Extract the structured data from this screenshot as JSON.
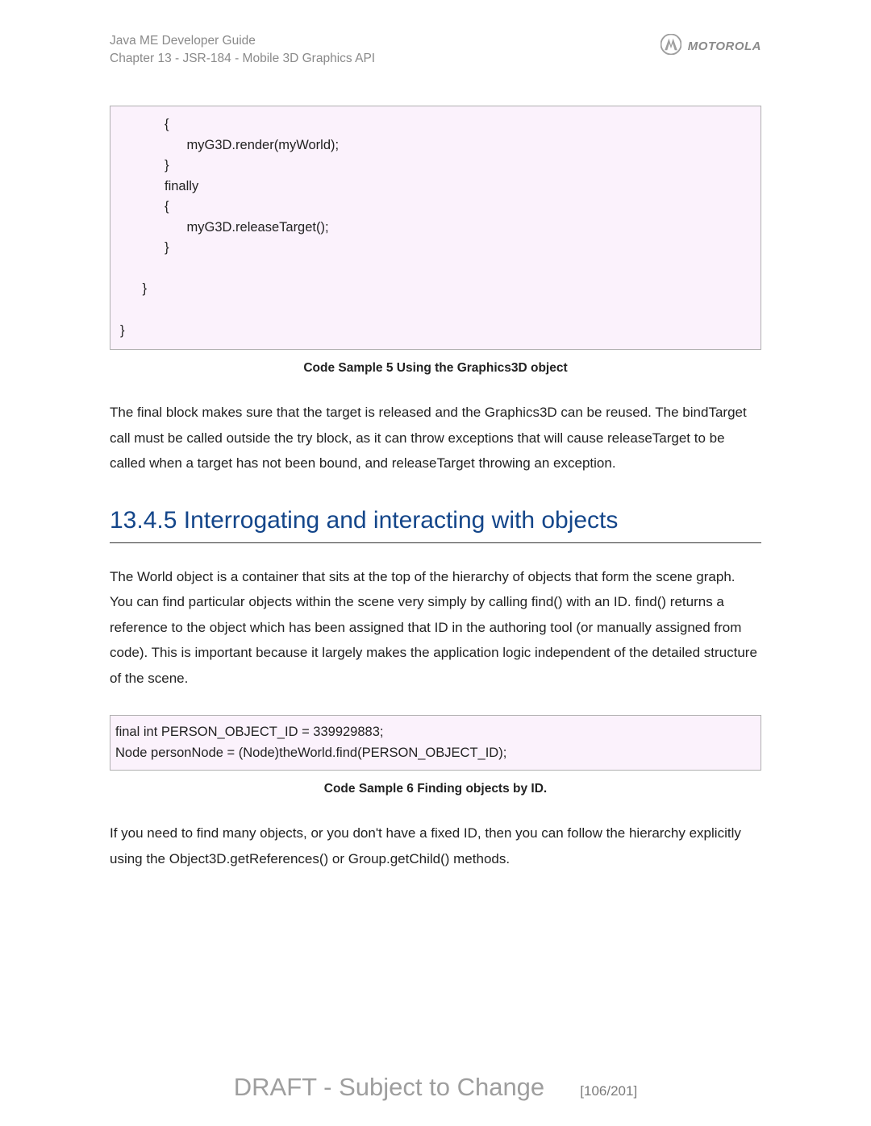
{
  "header": {
    "line1": "Java ME Developer Guide",
    "line2": "Chapter 13 - JSR-184 - Mobile 3D Graphics API",
    "brand": "MOTOROLA"
  },
  "code1": "            {\n                  myG3D.render(myWorld);\n            }\n            finally\n            {\n                  myG3D.releaseTarget();\n            }\n\n      }\n\n}",
  "caption1": "Code Sample 5 Using the Graphics3D object",
  "para1": "The final block makes sure that the target is released and the Graphics3D can be reused. The bindTarget call must be called outside the try block, as it can throw exceptions that will cause releaseTarget to be called when a target has not been bound, and releaseTarget throwing an exception.",
  "heading": "13.4.5 Interrogating and interacting with objects",
  "para2": "The World object is a container that sits at the top of the hierarchy of objects that form the scene graph. You can find particular objects within the scene very simply by calling find() with an ID. find() returns a reference to the object which has been assigned that ID in the authoring tool (or manually assigned from code). This is important because it largely makes the application logic independent of the detailed structure of the scene.",
  "code2": "final int PERSON_OBJECT_ID = 339929883;\nNode personNode = (Node)theWorld.find(PERSON_OBJECT_ID);",
  "caption2": "Code Sample 6 Finding objects by ID.",
  "para3": "If you need to find many objects, or you don't have a fixed ID, then you can follow the hierarchy explicitly using the Object3D.getReferences() or Group.getChild() methods.",
  "footer": {
    "draft": "DRAFT - Subject to Change",
    "page": "[106/201]"
  }
}
